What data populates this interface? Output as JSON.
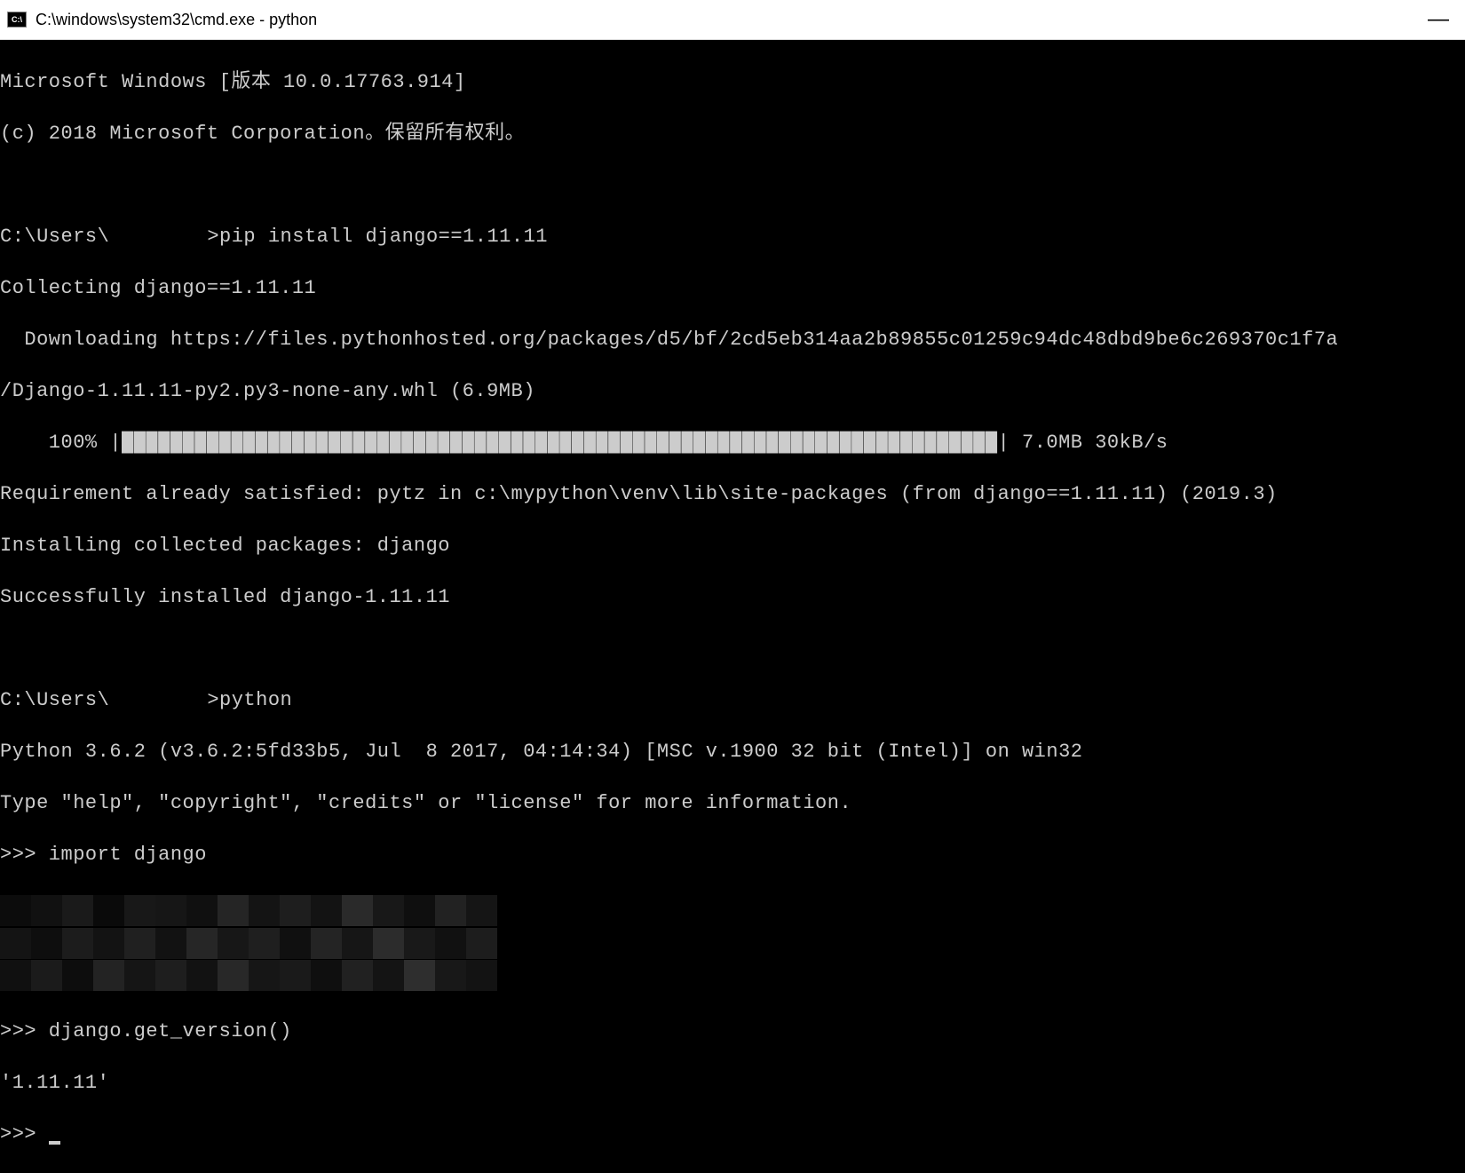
{
  "titlebar": {
    "icon_label": "C:\\",
    "title": "C:\\windows\\system32\\cmd.exe - python",
    "minimize": "—"
  },
  "terminal": {
    "line_win_version": "Microsoft Windows [版本 10.0.17763.914]",
    "line_copyright": "(c) 2018 Microsoft Corporation。保留所有权利。",
    "prompt1_prefix": "C:\\Users\\",
    "prompt1_suffix": ">pip install django==1.11.11",
    "line_collecting": "Collecting django==1.11.11",
    "line_downloading": "  Downloading https://files.pythonhosted.org/packages/d5/bf/2cd5eb314aa2b89855c01259c94dc48dbd9be6c269370c1f7a",
    "line_whl": "/Django-1.11.11-py2.py3-none-any.whl (6.9MB)",
    "progress_prefix": "    100% |",
    "progress_bar": "████████████████████████████████████████████████████████████████████████",
    "progress_suffix": "| 7.0MB 30kB/s",
    "line_requirement": "Requirement already satisfied: pytz in c:\\mypython\\venv\\lib\\site-packages (from django==1.11.11) (2019.3)",
    "line_installing": "Installing collected packages: django",
    "line_success": "Successfully installed django-1.11.11",
    "prompt2_prefix": "C:\\Users\\",
    "prompt2_suffix": ">python",
    "line_python_ver": "Python 3.6.2 (v3.6.2:5fd33b5, Jul  8 2017, 04:14:34) [MSC v.1900 32 bit (Intel)] on win32",
    "line_python_help": "Type \"help\", \"copyright\", \"credits\" or \"license\" for more information.",
    "repl1": ">>> import django",
    "repl2": ">>> django.get_version()",
    "repl2_result": "'1.11.11'",
    "repl3": ">>> "
  }
}
